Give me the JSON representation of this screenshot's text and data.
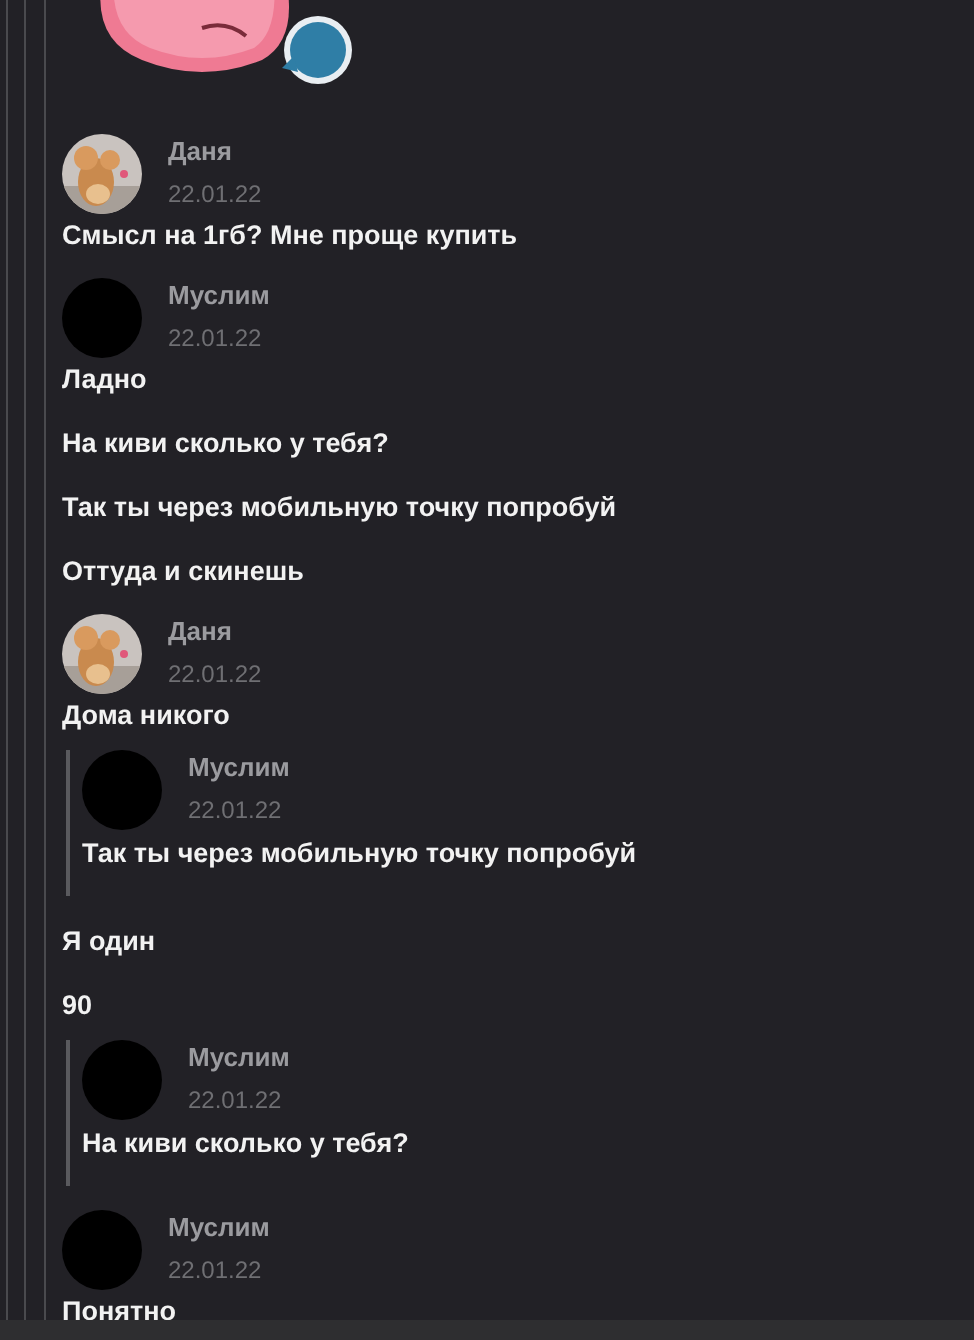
{
  "messages": [
    {
      "kind": "sticker"
    },
    {
      "kind": "author",
      "author": "Даня",
      "date": "22.01.22"
    },
    {
      "kind": "text",
      "text": "Смысл на 1гб? Мне проще купить"
    },
    {
      "kind": "author",
      "author": "Муслим",
      "date": "22.01.22",
      "avatar": {
        "kind": "blank"
      }
    },
    {
      "kind": "text",
      "text": "Ладно"
    },
    {
      "kind": "text",
      "text": "На киви сколько у тебя?"
    },
    {
      "kind": "text",
      "text": "Так ты через мобильную точку попробуй"
    },
    {
      "kind": "text",
      "text": "Оттуда и скинешь"
    },
    {
      "kind": "author",
      "author": "Даня",
      "date": "22.01.22"
    },
    {
      "kind": "text",
      "text": "Дома никого"
    },
    {
      "kind": "quote",
      "author": "Муслим",
      "date": "22.01.22",
      "avatar": {
        "kind": "blank"
      },
      "text": "Так ты через мобильную точку попробуй"
    },
    {
      "kind": "text",
      "text": "Я один"
    },
    {
      "kind": "text",
      "text": "90"
    },
    {
      "kind": "quote",
      "author": "Муслим",
      "date": "22.01.22",
      "avatar": {
        "kind": "blank"
      },
      "text": "На киви сколько у тебя?"
    },
    {
      "kind": "author",
      "author": "Муслим",
      "date": "22.01.22",
      "avatar": {
        "kind": "blank"
      }
    },
    {
      "kind": "text",
      "text": "Понятно"
    }
  ]
}
